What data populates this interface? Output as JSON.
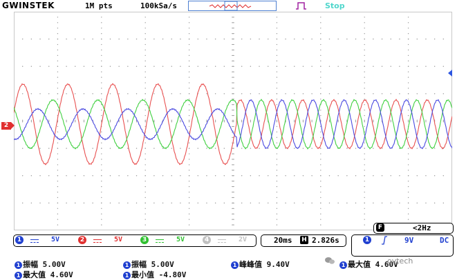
{
  "header": {
    "brand": "GWINSTEK",
    "memory_depth": "1M pts",
    "sample_rate": "100kSa/s",
    "run_state": "Stop"
  },
  "channels": [
    {
      "num": "1",
      "scale": "5V",
      "color": "#2040d0",
      "active": true
    },
    {
      "num": "2",
      "scale": "5V",
      "color": "#e03030",
      "active": true
    },
    {
      "num": "3",
      "scale": "5V",
      "color": "#30c030",
      "active": true
    },
    {
      "num": "4",
      "scale": "2V",
      "color": "#b0b0b0",
      "active": false
    }
  ],
  "channel_marker": "2",
  "timebase": {
    "scale": "20ms",
    "icon": "H",
    "position": "2.826s"
  },
  "trigger": {
    "source": "1",
    "slope": "rising-edge-icon",
    "level": "9V",
    "coupling": "DC"
  },
  "frequency": {
    "icon": "F",
    "value": "<2Hz"
  },
  "measurements": [
    {
      "source": "1",
      "label": "振幅",
      "value": "5.00V"
    },
    {
      "source": "1",
      "label": "振幅",
      "value": "5.00V"
    },
    {
      "source": "1",
      "label": "峰峰值",
      "value": "9.40V"
    },
    {
      "source": "1",
      "label": "最大值",
      "value": "4.60V"
    },
    {
      "source": "1",
      "label": "最大值",
      "value": "4.60V"
    },
    {
      "source": "1",
      "label": "最小值",
      "value": "-4.80V"
    }
  ],
  "watermark": "ovtech",
  "colors": {
    "ch1": "#4a4ae0",
    "ch2": "#e85050",
    "ch3": "#40d040",
    "accent": "#4fd6cc",
    "grid": "#9a9a9a"
  }
}
